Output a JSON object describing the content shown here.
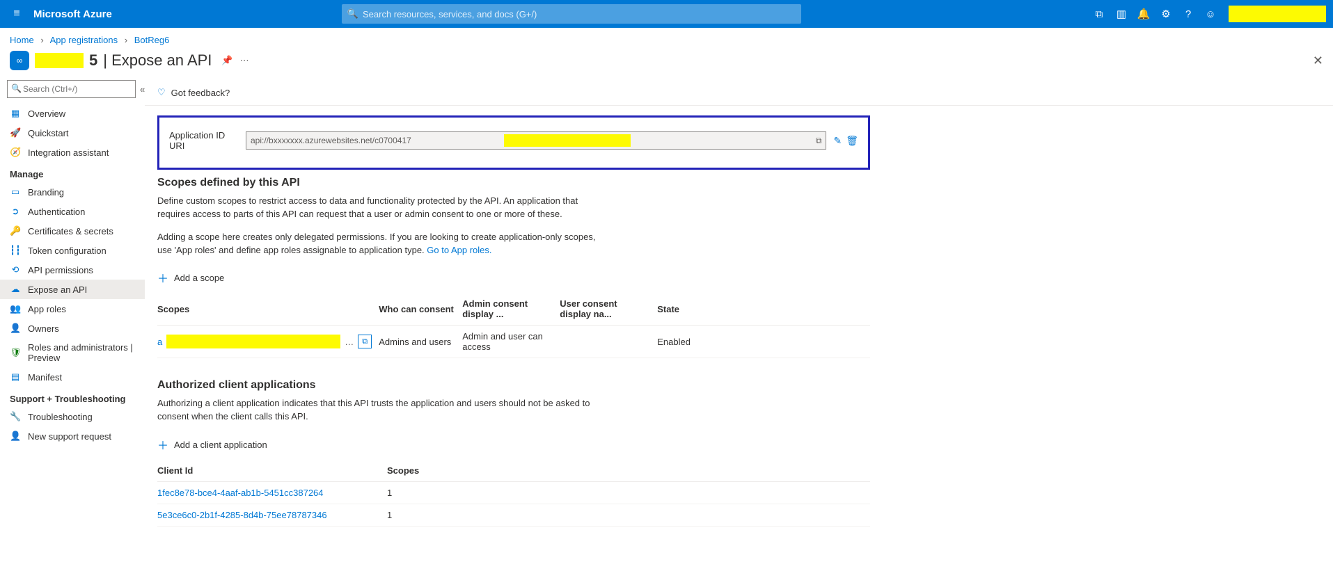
{
  "top": {
    "brand": "Microsoft Azure",
    "search_placeholder": "Search resources, services, and docs (G+/)"
  },
  "breadcrumbs": {
    "home": "Home",
    "appreg": "App registrations",
    "current": "BotReg6"
  },
  "header": {
    "redacted_suffix": "5",
    "sep": " | ",
    "title_rest": "Expose an API"
  },
  "sidebar": {
    "search_placeholder": "Search (Ctrl+/)",
    "items": {
      "overview": "Overview",
      "quickstart": "Quickstart",
      "integration": "Integration assistant"
    },
    "manage_label": "Manage",
    "manage": {
      "branding": "Branding",
      "auth": "Authentication",
      "certs": "Certificates & secrets",
      "token": "Token configuration",
      "apiperm": "API permissions",
      "expose": "Expose an API",
      "approles": "App roles",
      "owners": "Owners",
      "roles": "Roles and administrators | Preview",
      "manifest": "Manifest"
    },
    "support_label": "Support + Troubleshooting",
    "support": {
      "trouble": "Troubleshooting",
      "newreq": "New support request"
    }
  },
  "toolbar": {
    "feedback": "Got feedback?"
  },
  "uri": {
    "label": "Application ID URI",
    "value": "api://bxxxxxxx.azurewebsites.net/c0700417"
  },
  "scopes": {
    "heading": "Scopes defined by this API",
    "desc1": "Define custom scopes to restrict access to data and functionality protected by the API. An application that requires access to parts of this API can request that a user or admin consent to one or more of these.",
    "desc2a": "Adding a scope here creates only delegated permissions. If you are looking to create application-only scopes, use 'App roles' and define app roles assignable to application type. ",
    "desc2_link": "Go to App roles.",
    "add": "Add a scope",
    "cols": {
      "scopes": "Scopes",
      "who": "Who can consent",
      "admin": "Admin consent display ...",
      "user": "User consent display na...",
      "state": "State"
    },
    "row": {
      "scope_prefix": "a",
      "who": "Admins and users",
      "admin": "Admin and user can access",
      "user": "",
      "state": "Enabled"
    }
  },
  "clients": {
    "heading": "Authorized client applications",
    "desc": "Authorizing a client application indicates that this API trusts the application and users should not be asked to consent when the client calls this API.",
    "add": "Add a client application",
    "cols": {
      "id": "Client Id",
      "scopes": "Scopes"
    },
    "rows": [
      {
        "id": "1fec8e78-bce4-4aaf-ab1b-5451cc387264",
        "scopes": "1"
      },
      {
        "id": "5e3ce6c0-2b1f-4285-8d4b-75ee78787346",
        "scopes": "1"
      }
    ]
  }
}
